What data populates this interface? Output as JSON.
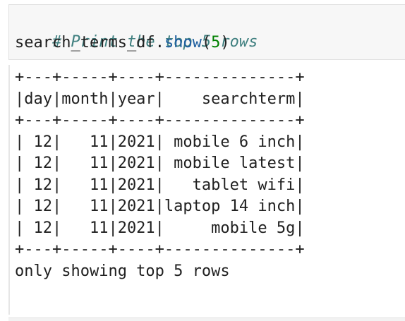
{
  "code_cell": {
    "comment": "# Print the top 5 rows",
    "code_obj": "search_terms_df",
    "code_dot": ".",
    "code_method": "show",
    "code_open": "(",
    "code_arg": "5",
    "code_close": ")"
  },
  "output": {
    "border_top": "+---+-----+----+--------------+",
    "header": "|day|month|year|    searchterm|",
    "border_mid": "+---+-----+----+--------------+",
    "rows": [
      "| 12|   11|2021| mobile 6 inch|",
      "| 12|   11|2021| mobile latest|",
      "| 12|   11|2021|   tablet wifi|",
      "| 12|   11|2021|laptop 14 inch|",
      "| 12|   11|2021|     mobile 5g|"
    ],
    "border_bottom": "+---+-----+----+--------------+",
    "footer": "only showing top 5 rows"
  }
}
